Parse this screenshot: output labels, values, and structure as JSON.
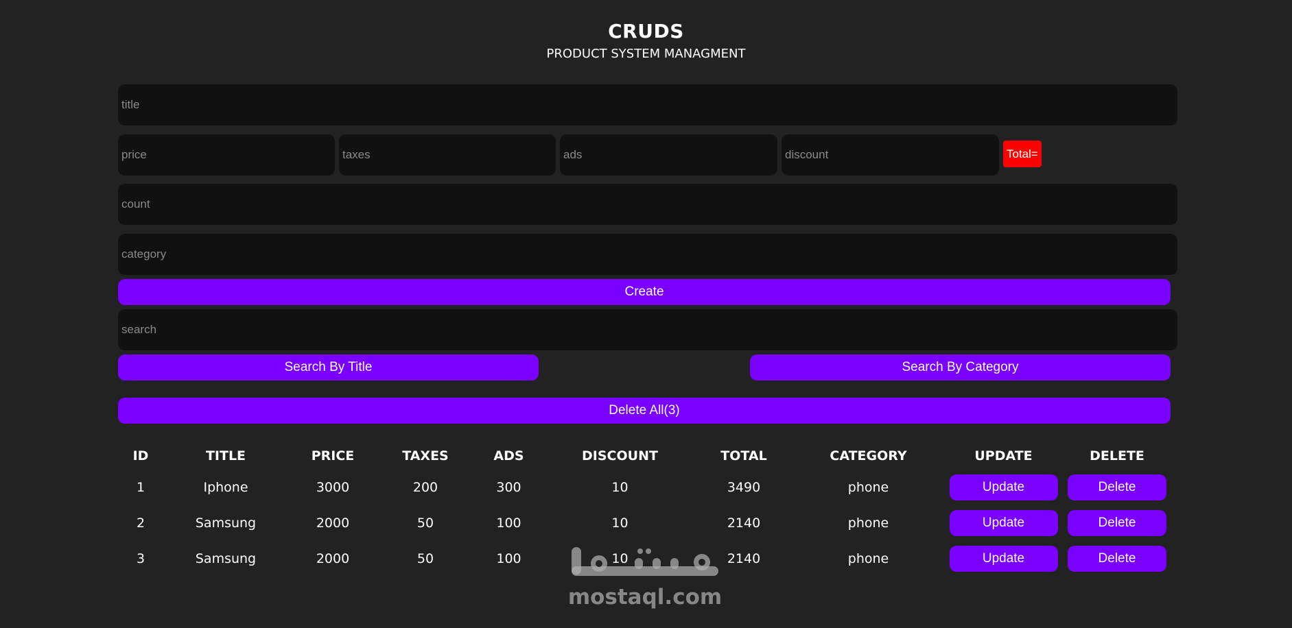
{
  "header": {
    "title": "CRUDS",
    "subtitle": "PRODUCT SYSTEM MANAGMENT"
  },
  "form": {
    "title_placeholder": "title",
    "price_placeholder": "price",
    "taxes_placeholder": "taxes",
    "ads_placeholder": "ads",
    "discount_placeholder": "discount",
    "total_label": "Total=",
    "count_placeholder": "count",
    "category_placeholder": "category",
    "create_label": "Create"
  },
  "search": {
    "placeholder": "search",
    "by_title_label": "Search By Title",
    "by_category_label": "Search By Category"
  },
  "delete_all_label": "Delete All(3)",
  "table": {
    "headers": [
      "ID",
      "TITLE",
      "PRICE",
      "TAXES",
      "ADS",
      "DISCOUNT",
      "TOTAL",
      "CATEGORY",
      "UPDATE",
      "DELETE"
    ],
    "rows": [
      {
        "id": "1",
        "title": "Iphone",
        "price": "3000",
        "taxes": "200",
        "ads": "300",
        "discount": "10",
        "total": "3490",
        "category": "phone",
        "update": "Update",
        "delete": "Delete"
      },
      {
        "id": "2",
        "title": "Samsung",
        "price": "2000",
        "taxes": "50",
        "ads": "100",
        "discount": "10",
        "total": "2140",
        "category": "phone",
        "update": "Update",
        "delete": "Delete"
      },
      {
        "id": "3",
        "title": "Samsung",
        "price": "2000",
        "taxes": "50",
        "ads": "100",
        "discount": "10",
        "total": "2140",
        "category": "phone",
        "update": "Update",
        "delete": "Delete"
      }
    ]
  },
  "watermark": {
    "logo": "مستقل",
    "text": "mostaql.com"
  },
  "colors": {
    "background": "#222222",
    "input_bg": "#111111",
    "accent": "#7a00ff",
    "total_badge": "#ff0000"
  }
}
